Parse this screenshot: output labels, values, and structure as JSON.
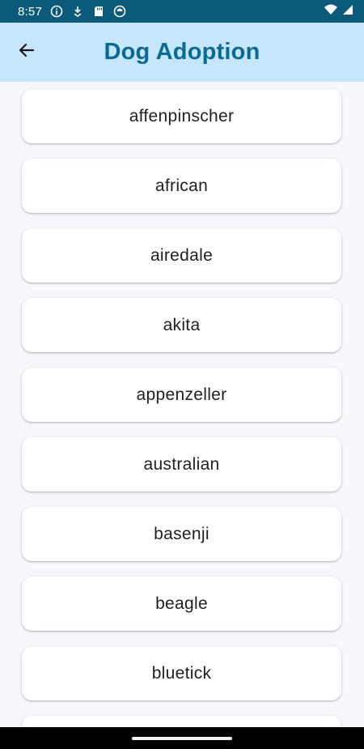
{
  "status_bar": {
    "time": "8:57",
    "left_icons": [
      "info-icon",
      "download-icon",
      "sd-card-icon",
      "sync-icon"
    ],
    "right_icons": [
      "wifi-icon",
      "cell-signal-icon"
    ]
  },
  "app_bar": {
    "title": "Dog Adoption",
    "back_icon": "arrow-left-icon",
    "background": "#c5e6fb",
    "title_color": "#0b6a93"
  },
  "breeds": [
    "affenpinscher",
    "african",
    "airedale",
    "akita",
    "appenzeller",
    "australian",
    "basenji",
    "beagle",
    "bluetick",
    ""
  ]
}
